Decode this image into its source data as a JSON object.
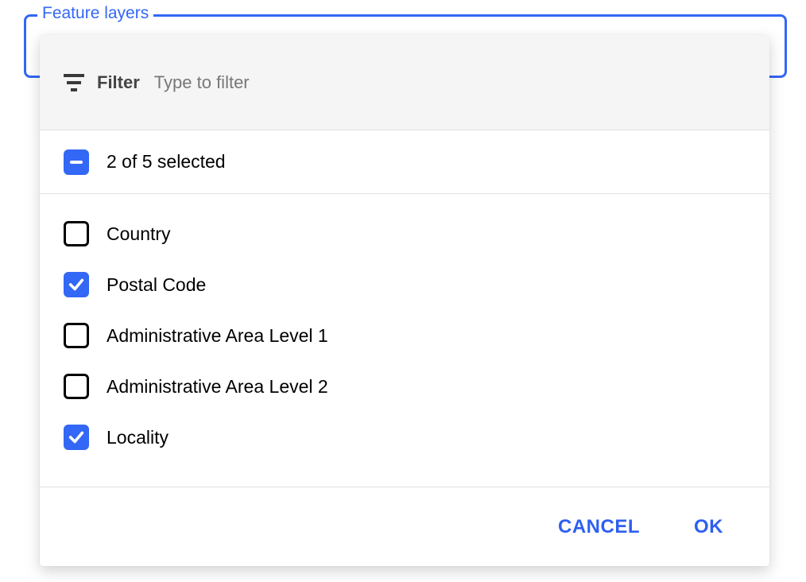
{
  "colors": {
    "accent": "#3367f5",
    "accent_text": "#2f5ff1"
  },
  "field": {
    "label": "Feature layers"
  },
  "filter": {
    "label": "Filter",
    "placeholder": "Type to filter",
    "value": ""
  },
  "summary": {
    "state": "indeterminate",
    "text": "2 of 5 selected"
  },
  "options": [
    {
      "label": "Country",
      "checked": false
    },
    {
      "label": "Postal Code",
      "checked": true
    },
    {
      "label": "Administrative Area Level 1",
      "checked": false
    },
    {
      "label": "Administrative Area Level 2",
      "checked": false
    },
    {
      "label": "Locality",
      "checked": true
    }
  ],
  "actions": {
    "cancel": "CANCEL",
    "ok": "OK"
  }
}
